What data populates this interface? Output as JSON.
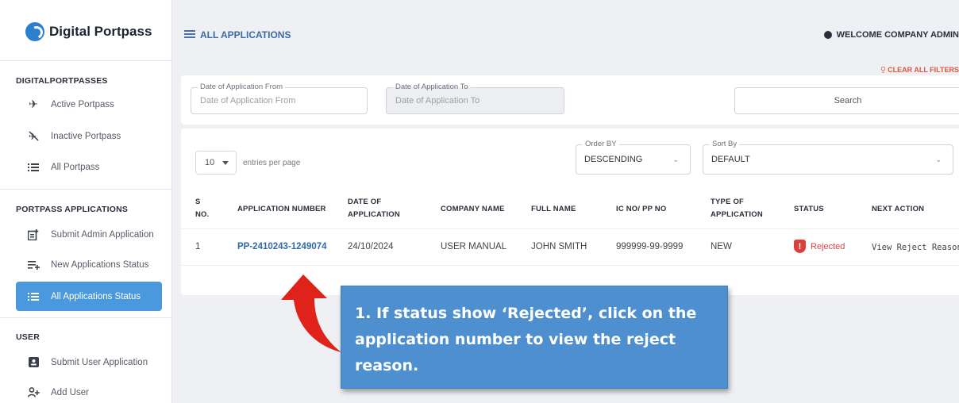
{
  "app": {
    "name": "Digital Portpass"
  },
  "header": {
    "title": "ALL APPLICATIONS",
    "welcome": "WELCOME COMPANY ADMIN",
    "clear_filters": "CLEAR ALL FILTERS"
  },
  "sidebar": {
    "sections": [
      {
        "title": "DIGITALPORTPASSES",
        "items": [
          {
            "label": "Active Portpass",
            "icon": "airplane-icon"
          },
          {
            "label": "Inactive Portpass",
            "icon": "airplane-off-icon"
          },
          {
            "label": "All Portpass",
            "icon": "list-icon"
          }
        ]
      },
      {
        "title": "PORTPASS APPLICATIONS",
        "items": [
          {
            "label": "Submit Admin Application",
            "icon": "add-document-icon"
          },
          {
            "label": "New Applications Status",
            "icon": "list-add-icon"
          },
          {
            "label": "All Applications Status",
            "icon": "list-icon",
            "active": true
          }
        ]
      },
      {
        "title": "USER",
        "items": [
          {
            "label": "Submit User Application",
            "icon": "id-card-icon"
          },
          {
            "label": "Add User",
            "icon": "add-user-icon"
          }
        ]
      }
    ]
  },
  "filters": {
    "date_from": {
      "label": "Date of Application From",
      "placeholder": "Date of Application From"
    },
    "date_to": {
      "label": "Date of Application To",
      "placeholder": "Date of Application To"
    },
    "search": {
      "placeholder": "Search"
    }
  },
  "table_controls": {
    "entries_value": "10",
    "entries_label": "entries per page",
    "order_by": {
      "label": "Order BY",
      "value": "DESCENDING"
    },
    "sort_by": {
      "label": "Sort By",
      "value": "DEFAULT"
    }
  },
  "table": {
    "headers": [
      "S NO.",
      "APPLICATION NUMBER",
      "DATE OF APPLICATION",
      "COMPANY NAME",
      "FULL NAME",
      "IC NO/ PP NO",
      "TYPE OF APPLICATION",
      "STATUS",
      "NEXT ACTION"
    ],
    "rows": [
      {
        "sno": "1",
        "app_no": "PP-2410243-1249074",
        "date": "24/10/2024",
        "company": "USER MANUAL",
        "full_name": "JOHN SMITH",
        "ic": "999999-99-9999",
        "type": "NEW",
        "status": "Rejected",
        "next_action": "View Reject Reason"
      }
    ]
  },
  "callout": {
    "text": "1. If status show ‘Rejected’, click on the application number to view the reject reason."
  },
  "colors": {
    "accent": "#4a98dd",
    "rejected": "#d9403a",
    "link": "#2f6aad",
    "callout": "#4e8fd0",
    "arrow": "#e0231a"
  }
}
